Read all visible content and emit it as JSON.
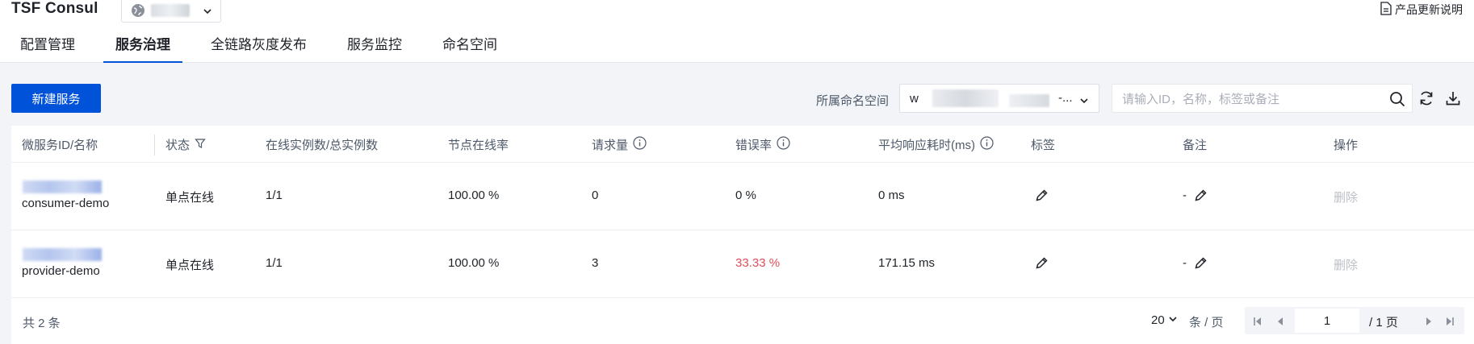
{
  "app": {
    "title": "TSF Consul",
    "release_notes": "产品更新说明"
  },
  "tabs": [
    {
      "label": "配置管理",
      "active": false
    },
    {
      "label": "服务治理",
      "active": true
    },
    {
      "label": "全链路灰度发布",
      "active": false
    },
    {
      "label": "服务监控",
      "active": false
    },
    {
      "label": "命名空间",
      "active": false
    }
  ],
  "toolbar": {
    "create_label": "新建服务",
    "namespace_label": "所属命名空间",
    "namespace_value": "w",
    "namespace_ellipsis": "-...",
    "search_placeholder": "请输入ID，名称，标签或备注"
  },
  "table": {
    "headers": {
      "id_name": "微服务ID/名称",
      "status": "状态",
      "instances": "在线实例数/总实例数",
      "node_rate": "节点在线率",
      "requests": "请求量",
      "error_rate": "错误率",
      "avg_latency": "平均响应耗时(ms)",
      "tags": "标签",
      "remark": "备注",
      "actions": "操作"
    },
    "rows": [
      {
        "name": "consumer-demo",
        "status": "单点在线",
        "instances": "1/1",
        "node_rate": "100.00 %",
        "requests": "0",
        "error_rate": "0 %",
        "avg_latency": "0 ms",
        "remark": "-",
        "action": "删除"
      },
      {
        "name": "provider-demo",
        "status": "单点在线",
        "instances": "1/1",
        "node_rate": "100.00 %",
        "requests": "3",
        "error_rate": "33.33 %",
        "avg_latency": "171.15 ms",
        "remark": "-",
        "action": "删除"
      }
    ]
  },
  "pagination": {
    "total": "共 2 条",
    "page_size": "20",
    "per_page": "条 / 页",
    "current_page": "1",
    "total_pages": "/ 1 页"
  },
  "colors": {
    "primary": "#0052d9",
    "error": "#e34d59",
    "disabled": "#bbbfc6"
  }
}
